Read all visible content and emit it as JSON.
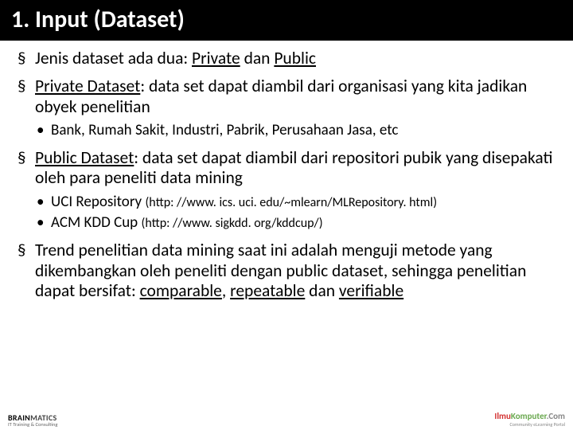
{
  "title": "1. Input (Dataset)",
  "bullets": {
    "b1_pre": "Jenis dataset ada dua: ",
    "b1_u1": "Private",
    "b1_mid": " dan ",
    "b1_u2": "Public",
    "b2_u": "Private Dataset",
    "b2_rest": ": data set dapat diambil dari organisasi yang kita jadikan obyek penelitian",
    "b2_sub1": "Bank, Rumah Sakit, Industri, Pabrik, Perusahaan Jasa, etc",
    "b3_u": "Public Dataset",
    "b3_rest": ": data set dapat diambil dari repositori pubik yang disepakati oleh para peneliti data mining",
    "b3_sub1_name": "UCI Repository ",
    "b3_sub1_link": "(http: //www. ics. uci. edu/~mlearn/MLRepository. html)",
    "b3_sub2_name": "ACM KDD Cup ",
    "b3_sub2_link": "(http: //www. sigkdd. org/kddcup/)",
    "b4_pre": "Trend penelitian data mining saat ini adalah menguji metode yang dikembangkan oleh peneliti dengan public dataset, sehingga penelitian dapat bersifat: ",
    "b4_u1": "comparable",
    "b4_c1": ", ",
    "b4_u2": "repeatable",
    "b4_c2": " dan ",
    "b4_u3": "verifiable"
  },
  "footer": {
    "left_brand_a": "BRAIN",
    "left_brand_b": "MATICS",
    "left_tag": "IT Training & Consulting",
    "right_a": "Ilmu",
    "right_b": "Komputer",
    "right_c": ".Com",
    "right_tag": "Community eLearning Portal"
  }
}
